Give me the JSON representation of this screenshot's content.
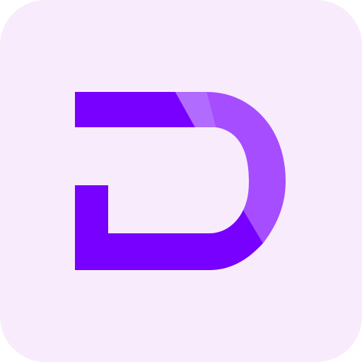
{
  "icon": {
    "name": "d-logo-icon",
    "colors": {
      "background": "#F8ECFC",
      "primary": "#7700FF",
      "accent": "#A64DFF",
      "accent_light": "#B26BFF"
    }
  }
}
